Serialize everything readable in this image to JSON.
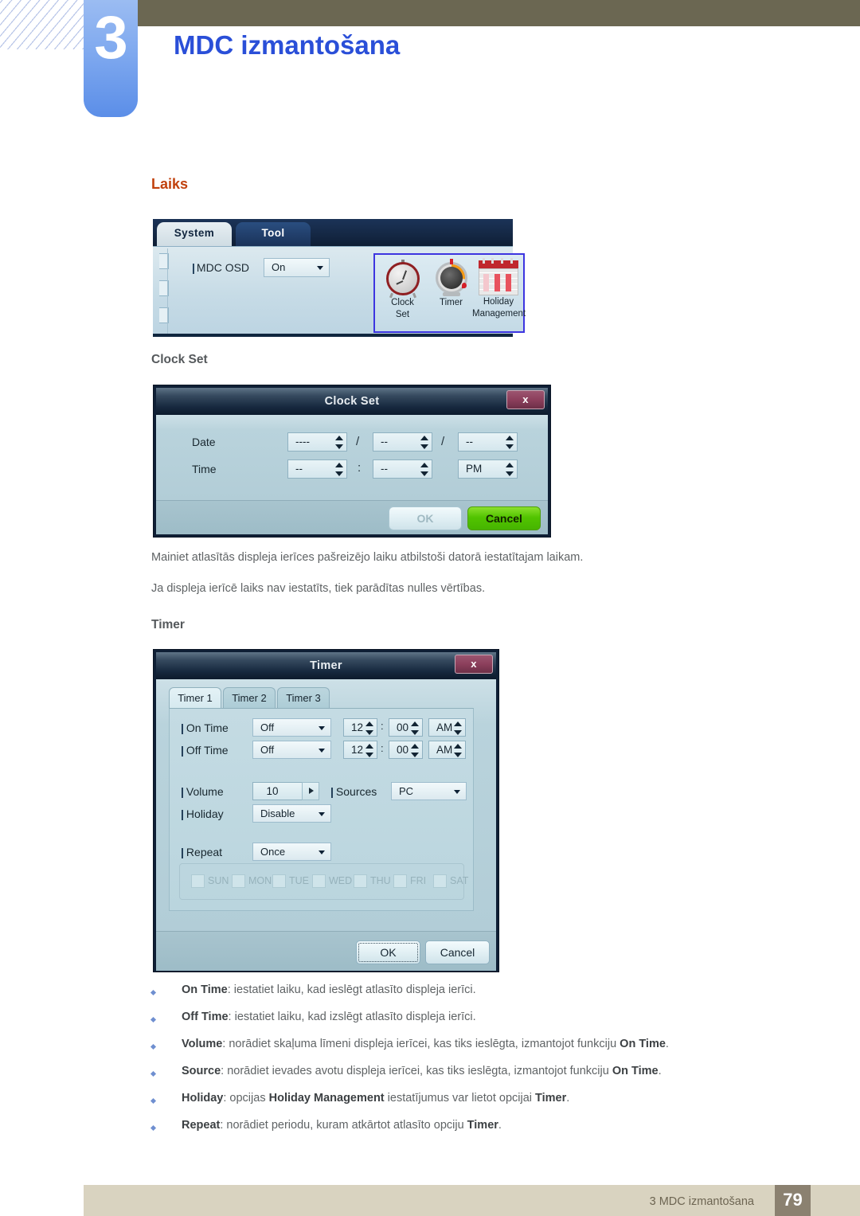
{
  "header": {
    "chapter_number": "3",
    "chapter_title": "MDC izmantošana"
  },
  "section": {
    "heading": "Laiks"
  },
  "mdc_panel": {
    "tabs": [
      {
        "label": "System",
        "active": true
      },
      {
        "label": "Tool",
        "active": false
      }
    ],
    "osd": {
      "label": "MDC OSD",
      "value": "On"
    },
    "icons": [
      {
        "name": "clock-set-icon",
        "label_line1": "Clock",
        "label_line2": "Set"
      },
      {
        "name": "timer-icon",
        "label_line1": "Timer",
        "label_line2": ""
      },
      {
        "name": "holiday-management-icon",
        "label_line1": "Holiday",
        "label_line2": "Management"
      }
    ],
    "highlight_color": "#3d35e0"
  },
  "clock_set": {
    "sub_heading": "Clock Set",
    "dialog_title": "Clock Set",
    "close_label": "x",
    "date_label": "Date",
    "time_label": "Time",
    "date_year": "----",
    "date_month": "--",
    "date_day": "--",
    "time_hour": "--",
    "time_minute": "--",
    "time_ampm": "PM",
    "separator_date": "/",
    "separator_time": ":",
    "ok_label": "OK",
    "cancel_label": "Cancel",
    "cancel_color": "#52c400"
  },
  "paragraphs": {
    "p1": "Mainiet atlasītās displeja ierīces pašreizējo laiku atbilstoši datorā iestatītajam laikam.",
    "p2": "Ja displeja ierīcē laiks nav iestatīts, tiek parādītas nulles vērtības."
  },
  "timer": {
    "sub_heading": "Timer",
    "dialog_title": "Timer",
    "close_label": "x",
    "tabs": [
      {
        "label": "Timer 1",
        "active": true
      },
      {
        "label": "Timer 2",
        "active": false
      },
      {
        "label": "Timer 3",
        "active": false
      }
    ],
    "rows": {
      "on_time": {
        "label": "On Time",
        "mode": "Off",
        "hour": "12",
        "minute": "00",
        "ampm": "AM"
      },
      "off_time": {
        "label": "Off Time",
        "mode": "Off",
        "hour": "12",
        "minute": "00",
        "ampm": "AM"
      },
      "volume": {
        "label": "Volume",
        "value": "10"
      },
      "sources": {
        "label": "Sources",
        "value": "PC"
      },
      "holiday": {
        "label": "Holiday",
        "value": "Disable"
      },
      "repeat": {
        "label": "Repeat",
        "value": "Once"
      }
    },
    "separator_time": ":",
    "days": [
      "SUN",
      "MON",
      "TUE",
      "WED",
      "THU",
      "FRI",
      "SAT"
    ],
    "ok_label": "OK",
    "cancel_label": "Cancel"
  },
  "bullets": [
    {
      "term": "On Time",
      "rest": ": iestatiet laiku, kad ieslēgt atlasīto displeja ierīci.",
      "term2": "",
      "rest2": ""
    },
    {
      "term": "Off Time",
      "rest": ": iestatiet laiku, kad izslēgt atlasīto displeja ierīci.",
      "term2": "",
      "rest2": ""
    },
    {
      "term": "Volume",
      "rest": ": norādiet skaļuma līmeni displeja ierīcei, kas tiks ieslēgta, izmantojot funkciju ",
      "term2": "On Time",
      "rest2": "."
    },
    {
      "term": "Source",
      "rest": ": norādiet ievades avotu displeja ierīcei, kas tiks ieslēgta, izmantojot funkciju ",
      "term2": "On Time",
      "rest2": "."
    },
    {
      "term": "Holiday",
      "rest": ": opcijas ",
      "term2": "Holiday Management",
      "rest2": " iestatījumus var lietot opcijai ",
      "term3": "Timer",
      "rest3": "."
    },
    {
      "term": "Repeat",
      "rest": ": norādiet periodu, kuram atkārtot atlasīto opciju ",
      "term2": "Timer",
      "rest2": "."
    }
  ],
  "footer": {
    "text": "3 MDC izmantošana",
    "page_number": "79"
  }
}
